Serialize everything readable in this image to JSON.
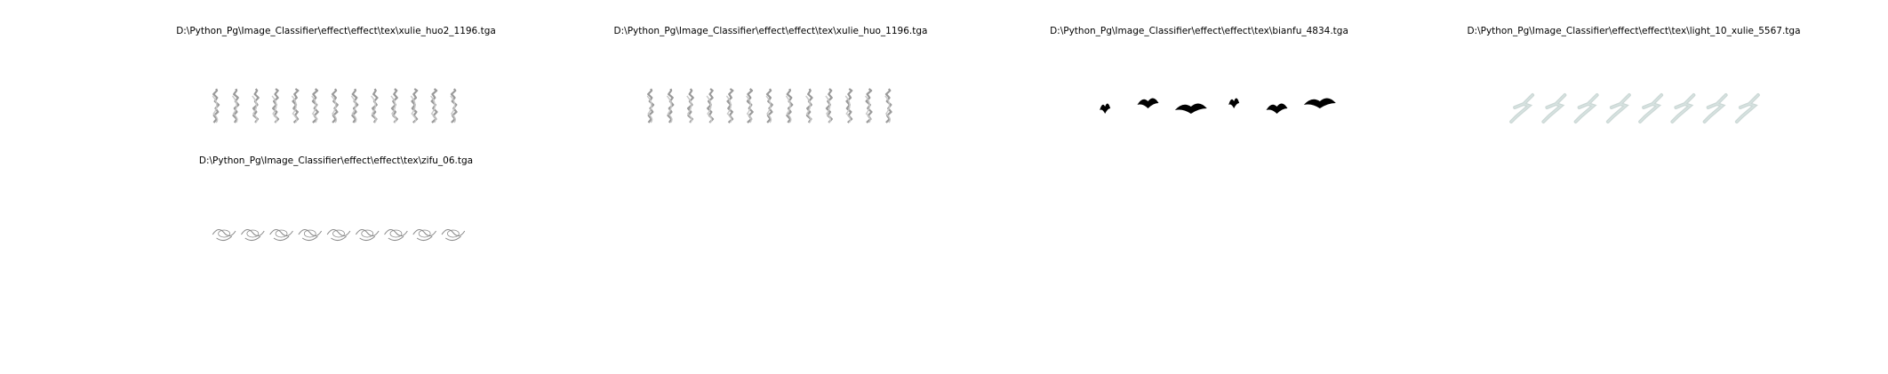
{
  "grid": {
    "panels": [
      {
        "title": "D:\\Python_Pg\\Image_Classifier\\effect\\effect\\tex\\xulie_huo2_1196.tga",
        "image_kind": "flame-sequence",
        "frame_count": 13,
        "tint": "#9a9a9a"
      },
      {
        "title": "D:\\Python_Pg\\Image_Classifier\\effect\\effect\\tex\\xulie_huo_1196.tga",
        "image_kind": "flame-sequence",
        "frame_count": 13,
        "tint": "#9a9a9a"
      },
      {
        "title": "D:\\Python_Pg\\Image_Classifier\\effect\\effect\\tex\\bianfu_4834.tga",
        "image_kind": "bat-sequence",
        "frame_count": 6,
        "tint": "#000000"
      },
      {
        "title": "D:\\Python_Pg\\Image_Classifier\\effect\\effect\\tex\\light_10_xulie_5567.tga",
        "image_kind": "lightning-sequence",
        "frame_count": 8,
        "tint": "#8fa8a4"
      },
      {
        "title": "D:\\Python_Pg\\Image_Classifier\\effect\\effect\\tex\\zifu_06.tga",
        "image_kind": "glyph-outline-sequence",
        "frame_count": 9,
        "tint": "#8a8a8a"
      }
    ]
  }
}
